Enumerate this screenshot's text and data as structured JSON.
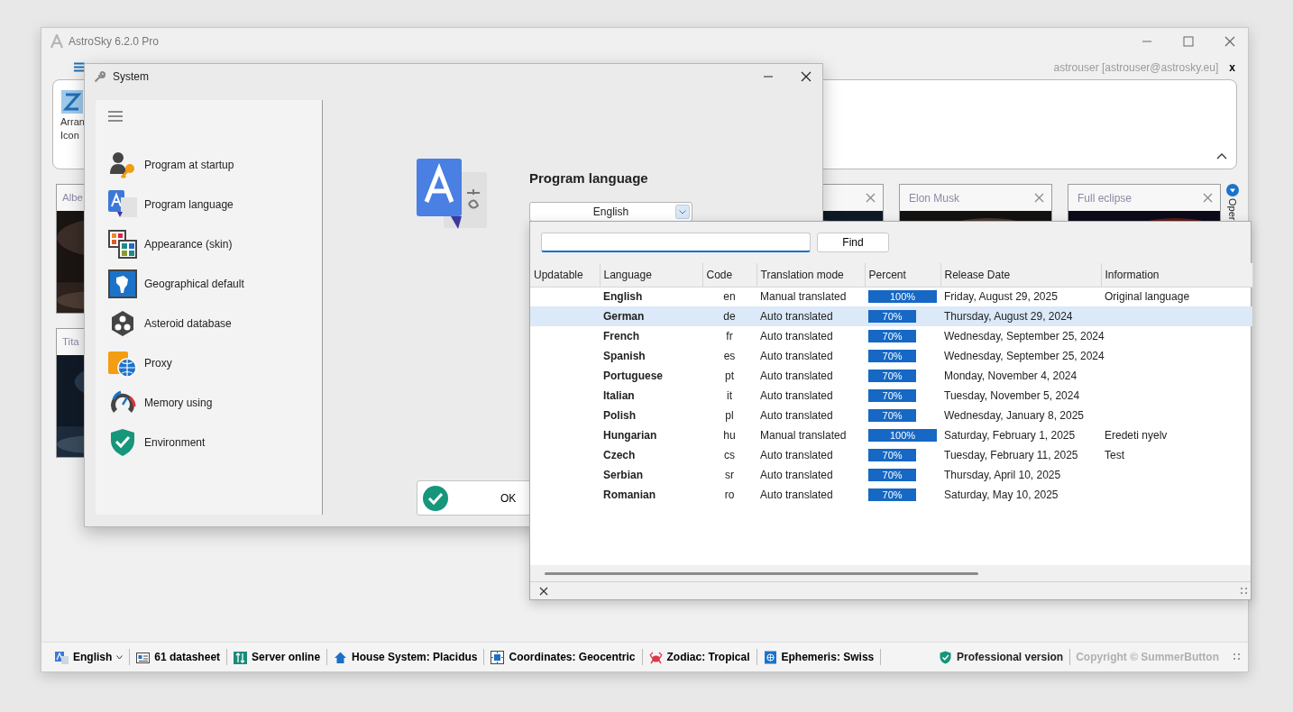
{
  "app": {
    "title": "AstroSky 6.2.0 Pro",
    "user": "astrouser [astrouser@astrosky.eu]",
    "sign_out": "x",
    "ribbon_button": {
      "label_lines": [
        "Arran",
        "Icon"
      ]
    },
    "cards_top": [
      {
        "kind": "titled",
        "title": "Albe"
      },
      {
        "kind": "untitled"
      },
      {
        "kind": "titled",
        "title": "Elon Musk"
      },
      {
        "kind": "titled",
        "title": "Full eclipse"
      }
    ],
    "cards_bottom": [
      {
        "kind": "titled",
        "title": "Tita"
      }
    ],
    "side_tab": "Oper",
    "status_bar": {
      "items": [
        {
          "kind": "language",
          "text": "English"
        },
        {
          "kind": "datasheet",
          "text": "61 datasheet"
        },
        {
          "kind": "server",
          "text": "Server online"
        },
        {
          "kind": "house",
          "text": "House System: Placidus"
        },
        {
          "kind": "coordinates",
          "text": "Coordinates: Geocentric"
        },
        {
          "kind": "zodiac",
          "text": "Zodiac: Tropical"
        },
        {
          "kind": "ephemeris",
          "text": "Ephemeris: Swiss"
        }
      ],
      "license": "Professional version",
      "copyright": "Copyright © SummerButton"
    }
  },
  "dialog": {
    "title": "System",
    "menu": [
      {
        "label": "Program at startup"
      },
      {
        "label": "Program language"
      },
      {
        "label": "Appearance (skin)"
      },
      {
        "label": "Geographical default"
      },
      {
        "label": "Asteroid database"
      },
      {
        "label": "Proxy"
      },
      {
        "label": "Memory using"
      },
      {
        "label": "Environment"
      }
    ],
    "heading": "Program language",
    "language_value": "English",
    "ok": "OK"
  },
  "language_popup": {
    "find": "Find",
    "columns": [
      "Updatable",
      "Language",
      "Code",
      "Translation mode",
      "Percent",
      "Release Date",
      "Information"
    ],
    "rows": [
      {
        "language": "English",
        "code": "en",
        "mode": "Manual translated",
        "percent": "100%",
        "level": 1,
        "date": "Friday, August 29, 2025",
        "information": "Original language",
        "selected": false
      },
      {
        "language": "German",
        "code": "de",
        "mode": "Auto translated",
        "percent": "70%",
        "level": 0.7,
        "date": "Thursday, August 29, 2024",
        "selected": true
      },
      {
        "language": "French",
        "code": "fr",
        "mode": "Auto translated",
        "percent": "70%",
        "level": 0.7,
        "date": "Wednesday, September 25, 2024",
        "selected": false
      },
      {
        "language": "Spanish",
        "code": "es",
        "mode": "Auto translated",
        "percent": "70%",
        "level": 0.7,
        "date": "Wednesday, September 25, 2024",
        "selected": false
      },
      {
        "language": "Portuguese",
        "code": "pt",
        "mode": "Auto translated",
        "percent": "70%",
        "level": 0.7,
        "date": "Monday, November 4, 2024",
        "selected": false
      },
      {
        "language": "Italian",
        "code": "it",
        "mode": "Auto translated",
        "percent": "70%",
        "level": 0.7,
        "date": "Tuesday, November 5, 2024",
        "selected": false
      },
      {
        "language": "Polish",
        "code": "pl",
        "mode": "Auto translated",
        "percent": "70%",
        "level": 0.7,
        "date": "Wednesday, January 8, 2025",
        "selected": false
      },
      {
        "language": "Hungarian",
        "code": "hu",
        "mode": "Manual translated",
        "percent": "100%",
        "level": 1,
        "date": "Saturday, February 1, 2025",
        "information": "Eredeti nyelv",
        "selected": false
      },
      {
        "language": "Czech",
        "code": "cs",
        "mode": "Auto translated",
        "percent": "70%",
        "level": 0.7,
        "date": "Tuesday, February 11, 2025",
        "information": "Test",
        "selected": false
      },
      {
        "language": "Serbian",
        "code": "sr",
        "mode": "Auto translated",
        "percent": "70%",
        "level": 0.7,
        "date": "Thursday, April 10, 2025",
        "selected": false
      },
      {
        "language": "Romanian",
        "code": "ro",
        "mode": "Auto translated",
        "percent": "70%",
        "level": 0.7,
        "date": "Saturday, May 10, 2025",
        "selected": false
      }
    ]
  }
}
